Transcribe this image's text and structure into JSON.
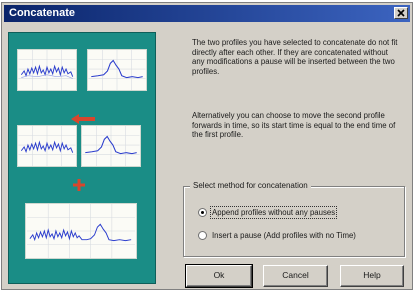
{
  "window": {
    "title": "Concatenate",
    "close_label": "×"
  },
  "description": {
    "paragraph1": "The two profiles you have selected to concatenate do not fit directly after each other. If they are concatenated without any modifications a pause will be inserted between the two profiles.",
    "paragraph2": "Alternatively you can choose to move the second profile forwards in time, so its start time is equal to the end time of the first profile."
  },
  "method_group": {
    "legend": "Select method for concatenation",
    "options": [
      {
        "label": "Append profiles without any pauses",
        "selected": true
      },
      {
        "label": "Insert a pause (Add profiles with no Time)",
        "selected": false
      }
    ]
  },
  "buttons": {
    "ok": "Ok",
    "cancel": "Cancel",
    "help": "Help"
  },
  "colors": {
    "illustration_bg": "#1a8d86",
    "arrow": "#d8462c",
    "signal": "#2a3ccd"
  }
}
